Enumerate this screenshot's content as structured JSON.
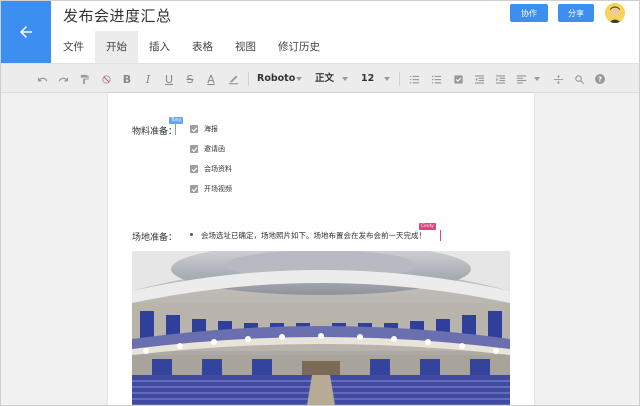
{
  "header": {
    "title": "发布会进度汇总",
    "menu": [
      {
        "label": "文件"
      },
      {
        "label": "开始"
      },
      {
        "label": "插入"
      },
      {
        "label": "表格"
      },
      {
        "label": "视图"
      },
      {
        "label": "修订历史"
      }
    ],
    "collab_label": "协作",
    "share_label": "分享"
  },
  "toolbar": {
    "font": "Roboto",
    "style": "正文",
    "size": "12"
  },
  "doc": {
    "materials_label": "物料准备：",
    "materials_cursor_tag": "Tony",
    "checklist": [
      {
        "label": "海报",
        "checked": true
      },
      {
        "label": "邀请函",
        "checked": true
      },
      {
        "label": "会场资料",
        "checked": true
      },
      {
        "label": "开场视频",
        "checked": true
      }
    ],
    "venue_label": "场地准备：",
    "venue_item": "会场选址已确定，场地照片如下。场地布置会在发布会前一天完成！",
    "venue_cursor_tag": "Cindy"
  },
  "colors": {
    "accent": "#3c8ff0",
    "tony_cursor": "#6aa5f0",
    "cindy_cursor": "#e0457b"
  }
}
